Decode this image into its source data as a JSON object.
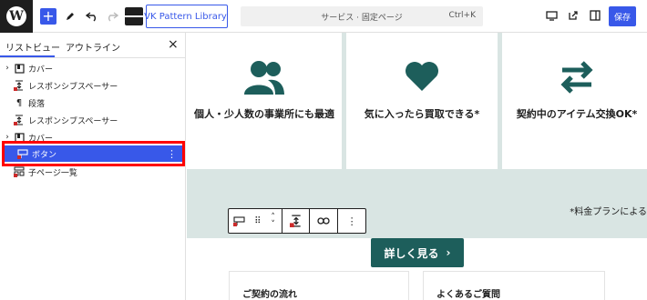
{
  "toolbar": {
    "wp_logo": "W",
    "add_icon": "+",
    "pattern_library_label": "VK Pattern Library",
    "command_title": "サービス · 固定ページ",
    "command_shortcut": "Ctrl+K",
    "save_label": "保存"
  },
  "panel": {
    "tab_list": "リストビュー",
    "tab_outline": "アウトライン",
    "close": "×",
    "items": [
      {
        "label": "カバー",
        "icon": "cover-icon"
      },
      {
        "label": "レスポンシブスペーサー",
        "icon": "spacer-icon"
      },
      {
        "label": "段落",
        "icon": "paragraph-icon"
      },
      {
        "label": "レスポンシブスペーサー",
        "icon": "spacer-icon"
      },
      {
        "label": "カバー",
        "icon": "cover-icon"
      },
      {
        "label": "ボタン",
        "icon": "button-icon"
      },
      {
        "label": "子ページ一覧",
        "icon": "child-pages-icon"
      }
    ]
  },
  "canvas": {
    "cards": [
      {
        "text": "個人・少人数の事業所にも最適",
        "icon": "users-icon"
      },
      {
        "text": "気に入ったら買取できる*",
        "icon": "heart-icon"
      },
      {
        "text": "契約中のアイテム交換OK*",
        "icon": "exchange-icon"
      }
    ],
    "note": "*料金プランによる",
    "detail_button": "詳しく見る",
    "detail_arrow": "›",
    "bottom_cards": [
      "ご契約の流れ",
      "よくあるご質問"
    ]
  },
  "colors": {
    "accent": "#3858e9",
    "teal": "#1d5e5b",
    "canvas_bg": "#d9e5e3",
    "highlight": "#ff0000"
  }
}
